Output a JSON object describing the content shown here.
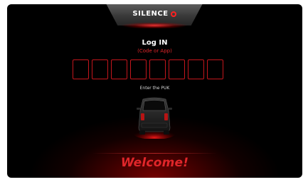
{
  "brand": {
    "name": "SILENCE",
    "logo_mark": "ring-icon",
    "accent_color": "#e0262a"
  },
  "login": {
    "title": "Log IN",
    "subtitle": "(Code or App)"
  },
  "code_input": {
    "box_count": 8,
    "values": [
      "",
      "",
      "",
      "",
      "",
      "",
      "",
      ""
    ],
    "label": "Enter the PUK"
  },
  "vehicle": {
    "image": "car-rear-view-icon"
  },
  "welcome": {
    "text": "Welcome!"
  },
  "colors": {
    "background": "#000000",
    "accent": "#e0262a",
    "text": "#ffffff"
  }
}
